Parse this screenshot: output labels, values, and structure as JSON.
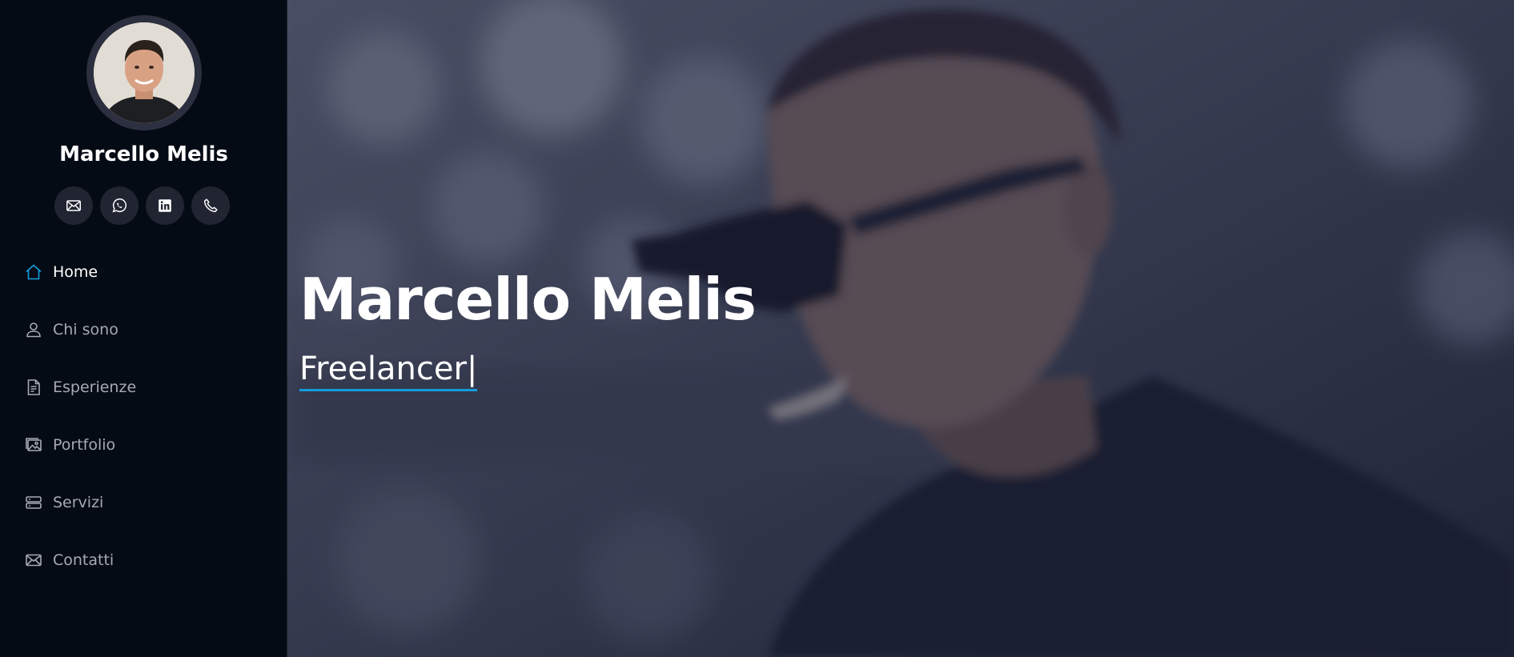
{
  "profile": {
    "name": "Marcello Melis",
    "avatar_icon": "profile-photo"
  },
  "social": [
    {
      "icon": "envelope-icon",
      "label": "Email"
    },
    {
      "icon": "whatsapp-icon",
      "label": "WhatsApp"
    },
    {
      "icon": "linkedin-icon",
      "label": "LinkedIn"
    },
    {
      "icon": "telephone-icon",
      "label": "Phone"
    }
  ],
  "nav": {
    "items": [
      {
        "label": "Home",
        "icon": "house-icon",
        "active": true
      },
      {
        "label": "Chi sono",
        "icon": "person-icon",
        "active": false
      },
      {
        "label": "Esperienze",
        "icon": "file-text-icon",
        "active": false
      },
      {
        "label": "Portfolio",
        "icon": "images-icon",
        "active": false
      },
      {
        "label": "Servizi",
        "icon": "server-icon",
        "active": false
      },
      {
        "label": "Contatti",
        "icon": "envelope-icon",
        "active": false
      }
    ]
  },
  "hero": {
    "title": "Marcello Melis",
    "subtitle": "Freelancer|"
  },
  "colors": {
    "accent": "#149ddd",
    "sidebar_bg": "#040b14",
    "social_bg": "#212431",
    "nav_text": "#a8a9b4"
  }
}
